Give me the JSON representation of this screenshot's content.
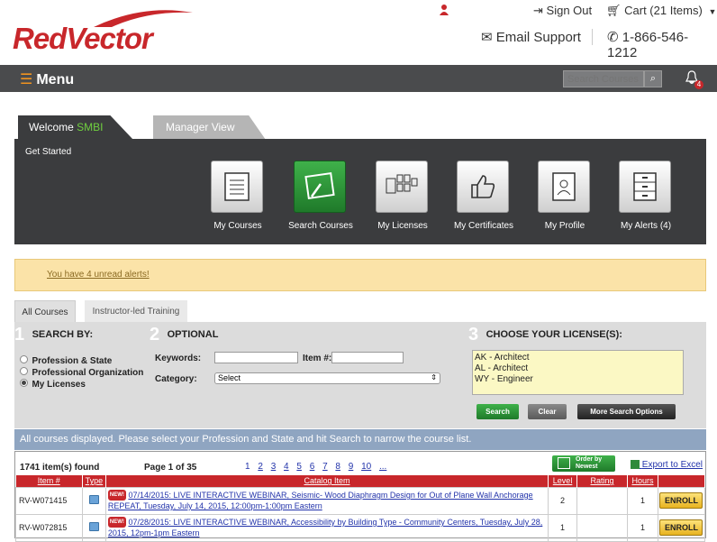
{
  "brand": {
    "logo_text": "RedVector",
    "accent": "#c8272b"
  },
  "header": {
    "sign_out": "Sign Out",
    "cart": "Cart (21 Items)",
    "email_support": "Email Support",
    "phone": "1-866-546-1212"
  },
  "menubar": {
    "menu_label": "Menu",
    "search_placeholder": "Search Courses",
    "alerts_count": "4"
  },
  "dashboard": {
    "tab_welcome_prefix": "Welcome",
    "tab_welcome_user": "SMBI",
    "tab_manager": "Manager View",
    "get_started": "Get Started",
    "tiles": [
      {
        "label": "My Courses",
        "icon": "notepad-icon"
      },
      {
        "label": "Search Courses",
        "icon": "search-courses-icon"
      },
      {
        "label": "My Licenses",
        "icon": "licenses-icon"
      },
      {
        "label": "My Certificates",
        "icon": "thumbs-up-icon"
      },
      {
        "label": "My Profile",
        "icon": "profile-icon"
      },
      {
        "label": "My Alerts (4)",
        "icon": "alerts-drawer-icon"
      }
    ]
  },
  "alert": {
    "text": "You have 4 unread alerts!"
  },
  "search": {
    "tabs": [
      "All Courses",
      "Instructor-led Training"
    ],
    "section1": {
      "num": "1",
      "title": "SEARCH BY:"
    },
    "section2": {
      "num": "2",
      "title": "OPTIONAL"
    },
    "section3": {
      "num": "3",
      "title": "CHOOSE YOUR LICENSE(S):"
    },
    "options": [
      "Profession & State",
      "Professional Organization",
      "My Licenses"
    ],
    "selected_option": "My Licenses",
    "keywords_label": "Keywords:",
    "item_label": "Item #:",
    "category_label": "Category:",
    "category_value": "Select",
    "licenses": [
      "AK - Architect",
      "AL - Architect",
      "WY - Engineer"
    ],
    "btn_search": "Search",
    "btn_clear": "Clear",
    "btn_more": "More Search Options"
  },
  "info_bar": "All courses displayed. Please select your Profession and State and hit Search to narrow the course list.",
  "results": {
    "count": "1741 item(s) found",
    "page_of": "Page 1 of 35",
    "pages": [
      "1",
      "2",
      "3",
      "4",
      "5",
      "6",
      "7",
      "8",
      "9",
      "10",
      "..."
    ],
    "order_btn_line1": "Order by",
    "order_btn_line2": "Newest",
    "export": "Export to Excel",
    "columns": [
      "Item #",
      "Type",
      "Catalog Item",
      "Level",
      "Rating",
      "Hours",
      ""
    ],
    "rows": [
      {
        "item": "RV-W071415",
        "new": "NEW!",
        "catalog": "07/14/2015: LIVE INTERACTIVE WEBINAR, Seismic- Wood Diaphragm Design for Out of Plane Wall Anchorage REPEAT, Tuesday, July 14, 2015, 12:00pm-1:00pm Eastern",
        "level": "2",
        "rating": "",
        "hours": "1",
        "action": "ENROLL"
      },
      {
        "item": "RV-W072815",
        "new": "NEW!",
        "catalog": "07/28/2015: LIVE INTERACTIVE WEBINAR, Accessibility by Building Type - Community Centers, Tuesday, July 28, 2015, 12pm-1pm Eastern",
        "level": "1",
        "rating": "",
        "hours": "1",
        "action": "ENROLL"
      }
    ]
  }
}
